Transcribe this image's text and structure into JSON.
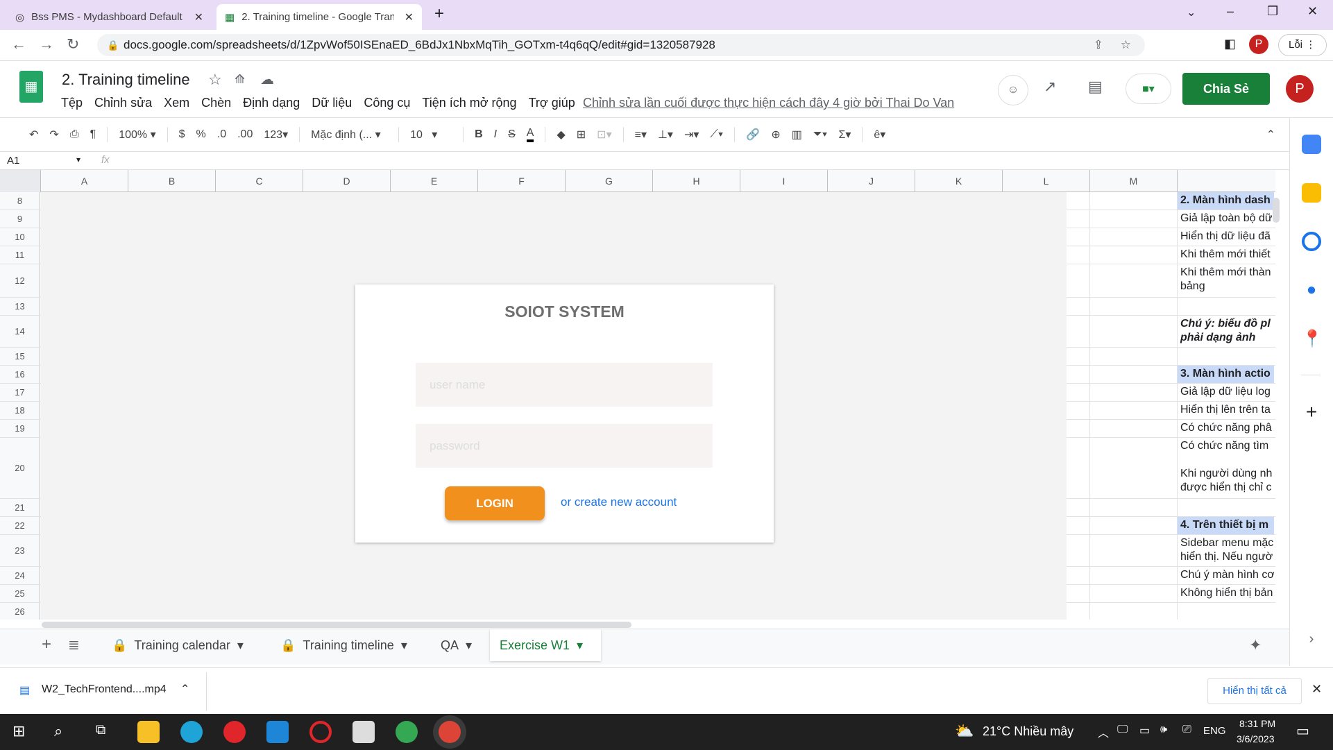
{
  "browser": {
    "tabs": [
      {
        "title": "Bss PMS - Mydashboard Default"
      },
      {
        "title": "2. Training timeline - Google Tran"
      }
    ],
    "url": "docs.google.com/spreadsheets/d/1ZpvWof50ISEnaED_6BdJx1NbxMqTih_GOTxm-t4q6qQ/edit#gid=1320587928",
    "profile_initial": "P",
    "error_label": "Lỗi"
  },
  "doc": {
    "title": "2. Training timeline",
    "menu": [
      "Tệp",
      "Chỉnh sửa",
      "Xem",
      "Chèn",
      "Định dạng",
      "Dữ liệu",
      "Công cụ",
      "Tiện ích mở rộng",
      "Trợ giúp"
    ],
    "last_edit": "Chỉnh sửa lần cuối được thực hiện cách đây 4 giờ bởi Thai Do Van",
    "share_label": "Chia Sẻ",
    "avatar": "P"
  },
  "toolbar": {
    "zoom": "100%",
    "currency": "$",
    "percent": "%",
    "dec_less": ".0",
    "dec_more": ".00",
    "format": "123",
    "font": "Mặc định (...",
    "size": "10",
    "bold": "B",
    "italic": "I",
    "strike": "S",
    "text_color": "A"
  },
  "formula": {
    "cell_ref": "A1",
    "fx": "fx"
  },
  "columns": [
    "A",
    "B",
    "C",
    "D",
    "E",
    "F",
    "G",
    "H",
    "I",
    "J",
    "K",
    "L",
    "M"
  ],
  "rows": [
    {
      "n": "8",
      "text": "2. Màn hình dash",
      "style": "hd"
    },
    {
      "n": "9",
      "text": "Giả lập toàn bộ dữ"
    },
    {
      "n": "10",
      "text": "Hiển thị dữ liệu đã"
    },
    {
      "n": "11",
      "text": "Khi thêm mới thiết"
    },
    {
      "n": "12",
      "text": "Khi thêm mới thàn\nbảng"
    },
    {
      "n": "13",
      "text": ""
    },
    {
      "n": "14",
      "text": "Chú ý: biểu đồ pl\nphải dạng ảnh",
      "style": "note"
    },
    {
      "n": "15",
      "text": ""
    },
    {
      "n": "16",
      "text": "3. Màn hình actio",
      "style": "hd"
    },
    {
      "n": "17",
      "text": "Giả lập dữ liệu log"
    },
    {
      "n": "18",
      "text": "Hiển thị lên trên ta"
    },
    {
      "n": "19",
      "text": "Có chức năng phâ"
    },
    {
      "n": "20",
      "text": "Có chức năng tìm\n\nKhi người dùng nh\nđược hiển thị chỉ c"
    },
    {
      "n": "21",
      "text": ""
    },
    {
      "n": "22",
      "text": "4. Trên thiết bị m",
      "style": "hd"
    },
    {
      "n": "23",
      "text": "Sidebar menu mặc\nhiển thị. Nếu ngườ"
    },
    {
      "n": "24",
      "text": "Chú ý màn hình cơ"
    },
    {
      "n": "25",
      "text": "Không hiển thị bản"
    },
    {
      "n": "26",
      "text": ""
    }
  ],
  "login": {
    "title": "SOIOT SYSTEM",
    "username_placeholder": "user name",
    "password_placeholder": "password",
    "login_label": "LOGIN",
    "create_link": "or create new account"
  },
  "sheets": [
    {
      "name": "Training calendar",
      "locked": true
    },
    {
      "name": "Training timeline",
      "locked": true
    },
    {
      "name": "QA"
    },
    {
      "name": "Exercise W1",
      "active": true
    }
  ],
  "download": {
    "file": "W2_TechFrontend....mp4",
    "show_all": "Hiển thị tất cả"
  },
  "taskbar": {
    "weather": "21°C  Nhiều mây",
    "lang": "ENG",
    "time": "8:31 PM",
    "date": "3/6/2023"
  }
}
